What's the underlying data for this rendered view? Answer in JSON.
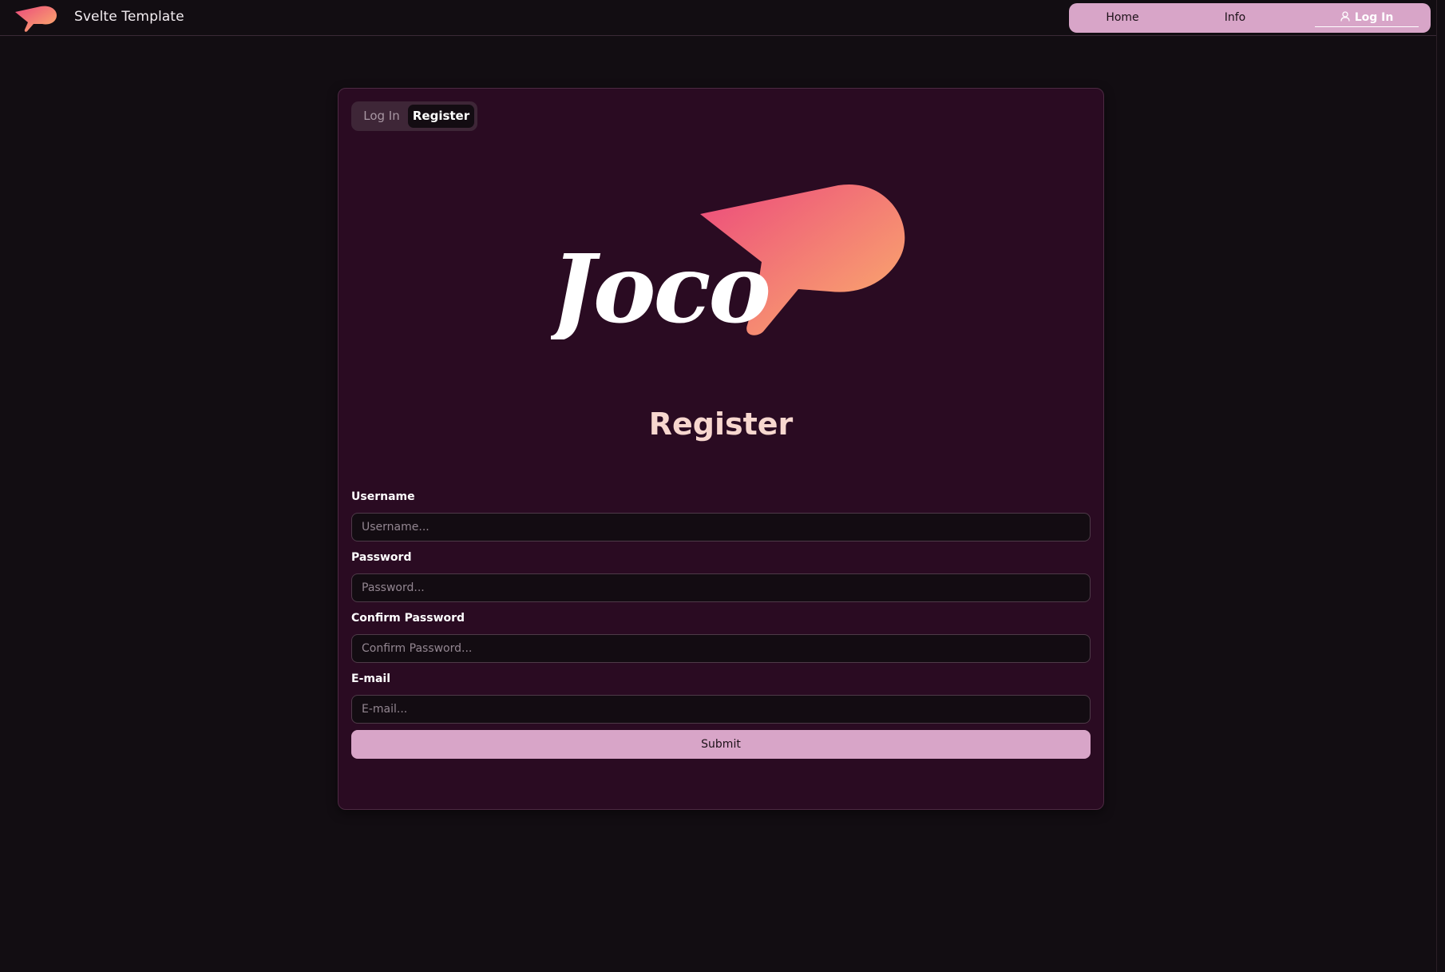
{
  "header": {
    "brand_title": "Svelte Template",
    "logo_icon": "joco-bubble-logo",
    "nav": {
      "home_label": "Home",
      "info_label": "Info",
      "login_label": "Log In",
      "login_icon": "user-icon"
    }
  },
  "tabs": {
    "login_label": "Log In",
    "register_label": "Register",
    "active": "Register"
  },
  "logo": {
    "wordmark": "Joco"
  },
  "form": {
    "title": "Register",
    "username": {
      "label": "Username",
      "placeholder": "Username..."
    },
    "password": {
      "label": "Password",
      "placeholder": "Password..."
    },
    "confirm_password": {
      "label": "Confirm Password",
      "placeholder": "Confirm Password..."
    },
    "email": {
      "label": "E-mail",
      "placeholder": "E-mail..."
    },
    "submit_label": "Submit"
  },
  "colors": {
    "page_bg": "#120d12",
    "card_bg": "#2a0b22",
    "accent_pink": "#d8a5c8",
    "title_peach": "#f7d7cf",
    "logo_gradient_start": "#ec4a7c",
    "logo_gradient_end": "#fbb26c"
  }
}
